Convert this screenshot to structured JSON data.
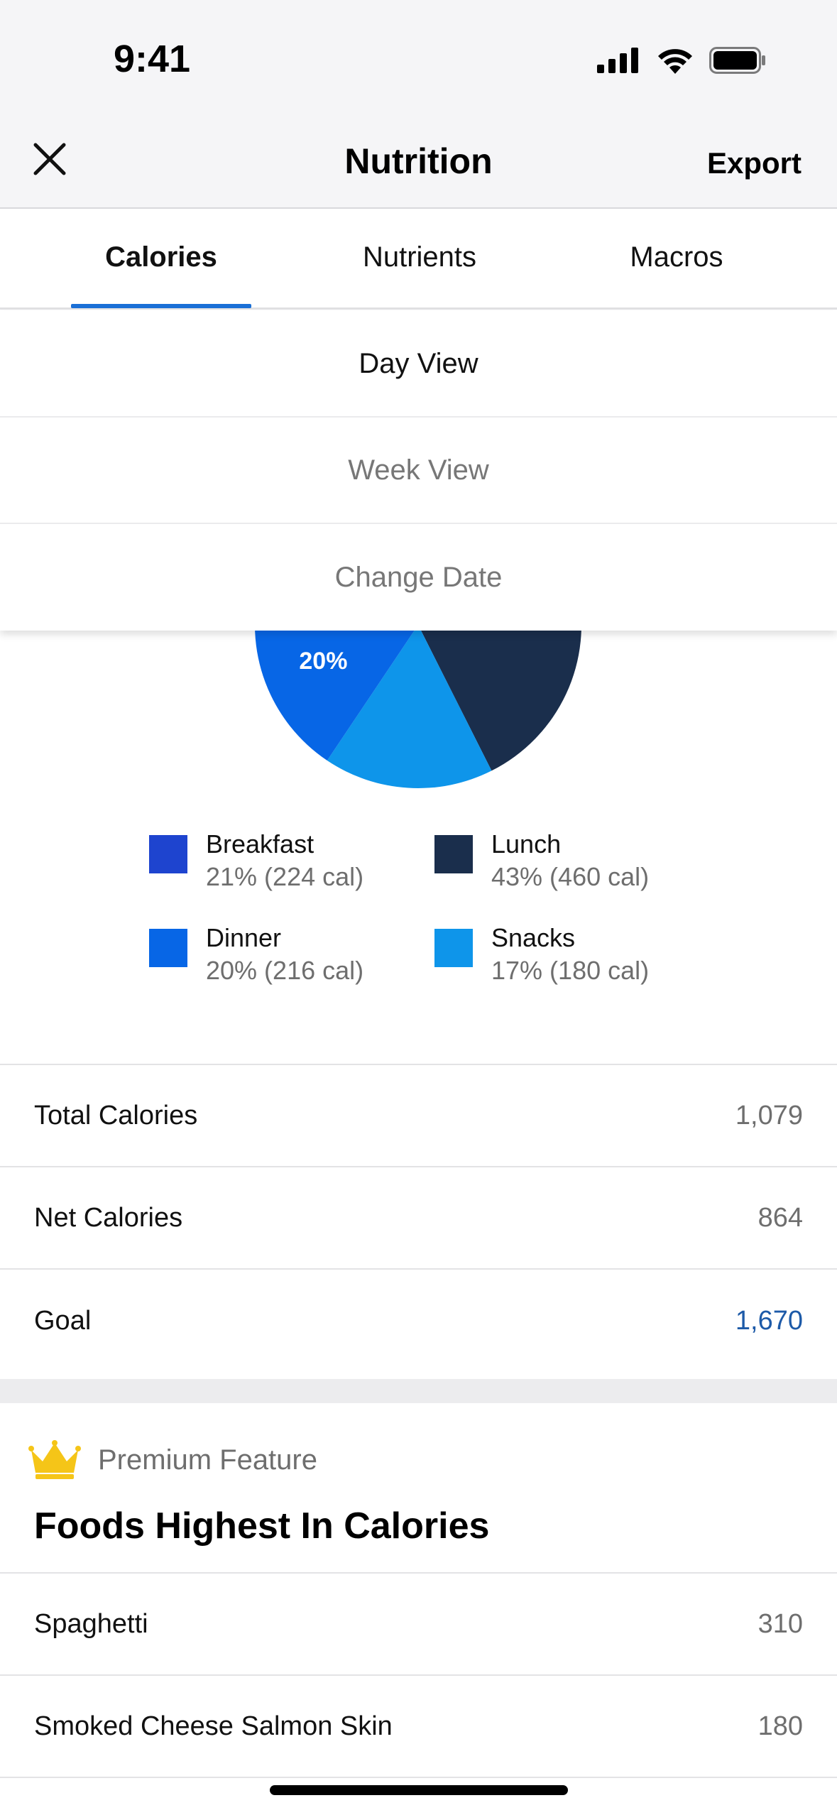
{
  "status_bar": {
    "time": "9:41"
  },
  "nav": {
    "title": "Nutrition",
    "export_label": "Export"
  },
  "tabs": [
    {
      "label": "Calories",
      "active": true
    },
    {
      "label": "Nutrients",
      "active": false
    },
    {
      "label": "Macros",
      "active": false
    }
  ],
  "menu": {
    "items": [
      {
        "label": "Day View",
        "selected": true
      },
      {
        "label": "Week View",
        "selected": false
      },
      {
        "label": "Change Date",
        "selected": false
      }
    ]
  },
  "chart_data": {
    "type": "pie",
    "slices": [
      {
        "name": "Breakfast",
        "percent": 21,
        "calories": 224,
        "color": "#1e44cf",
        "label": "21%",
        "detail": "21% (224 cal)"
      },
      {
        "name": "Lunch",
        "percent": 43,
        "calories": 460,
        "color": "#1a2e4c",
        "label": "",
        "detail": "43% (460 cal)"
      },
      {
        "name": "Dinner",
        "percent": 20,
        "calories": 216,
        "color": "#0766e6",
        "label": "20%",
        "detail": "20% (216 cal)"
      },
      {
        "name": "Snacks",
        "percent": 17,
        "calories": 180,
        "color": "#0e95ea",
        "label": "",
        "detail": "17% (180 cal)"
      }
    ]
  },
  "summary": {
    "total_label": "Total Calories",
    "total_value": "1,079",
    "net_label": "Net Calories",
    "net_value": "864",
    "goal_label": "Goal",
    "goal_value": "1,670"
  },
  "premium": {
    "badge_label": "Premium Feature",
    "title": "Foods Highest In Calories",
    "foods": [
      {
        "name": "Spaghetti",
        "calories": "310"
      },
      {
        "name": "Smoked Cheese Salmon Skin",
        "calories": "180"
      }
    ]
  },
  "colors": {
    "accent": "#1a6fd6",
    "goal": "#1d5aa8",
    "crown": "#f5c518"
  }
}
